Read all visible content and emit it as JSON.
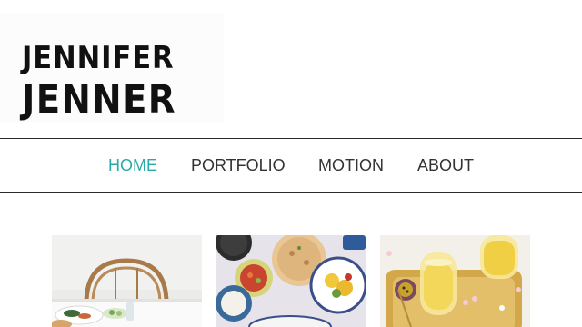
{
  "brand": {
    "line1": "JENNIFER",
    "line2": "JENNER"
  },
  "nav": {
    "items": [
      {
        "label": "HOME",
        "active": true
      },
      {
        "label": "PORTFOLIO",
        "active": false
      },
      {
        "label": "MOTION",
        "active": false
      },
      {
        "label": "ABOUT",
        "active": false
      }
    ]
  },
  "colors": {
    "accent": "#2aa9a8",
    "text": "#333333",
    "logo": "#111111"
  },
  "gallery": {
    "items": [
      {
        "subject": "table setting with bentwood chair"
      },
      {
        "subject": "overhead brunch spread with flatbreads"
      },
      {
        "subject": "citrus drinks on a brass tray"
      }
    ]
  }
}
